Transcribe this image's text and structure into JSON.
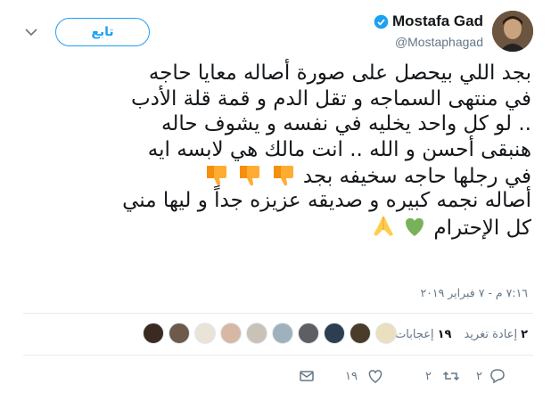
{
  "header": {
    "display_name": "Mostafa Gad",
    "handle": "@Mostaphagad",
    "follow_label": "تابع"
  },
  "tweet": {
    "lines": [
      "بجد اللي بيحصل على صورة أصاله معايا حاجه",
      "في منتهى السماجه و تقل الدم و قمة قلة الأدب",
      ".. لو كل واحد يخليه في نفسه و يشوف حاله",
      "هنبقى أحسن و الله .. انت مالك هي لابسه ايه",
      "في رجلها حاجه سخيفه بجد",
      "أصاله نجمه كبيره و صديقه عزيزه جداً و ليها مني",
      "كل الإحترام"
    ],
    "emojis": {
      "thumbs": [
        "thumbs-down-icon",
        "thumbs-down-icon",
        "thumbs-down-icon"
      ],
      "end": [
        "green-heart-icon",
        "folded-hands-icon"
      ]
    },
    "timestamp": "٧:١٦ م - ٧ فبراير ٢٠١٩"
  },
  "stats": {
    "retweets_count": "٢",
    "retweets_label": "إعادة تغريد",
    "likes_count": "١٩",
    "likes_label": "إعجابات"
  },
  "actions": {
    "reply_count": "٢",
    "retweet_count": "٢",
    "like_count": "١٩"
  },
  "colors": {
    "accent": "#1da1f2",
    "muted": "#657786",
    "heart": "#78b159",
    "thumb": "#ffac33"
  }
}
